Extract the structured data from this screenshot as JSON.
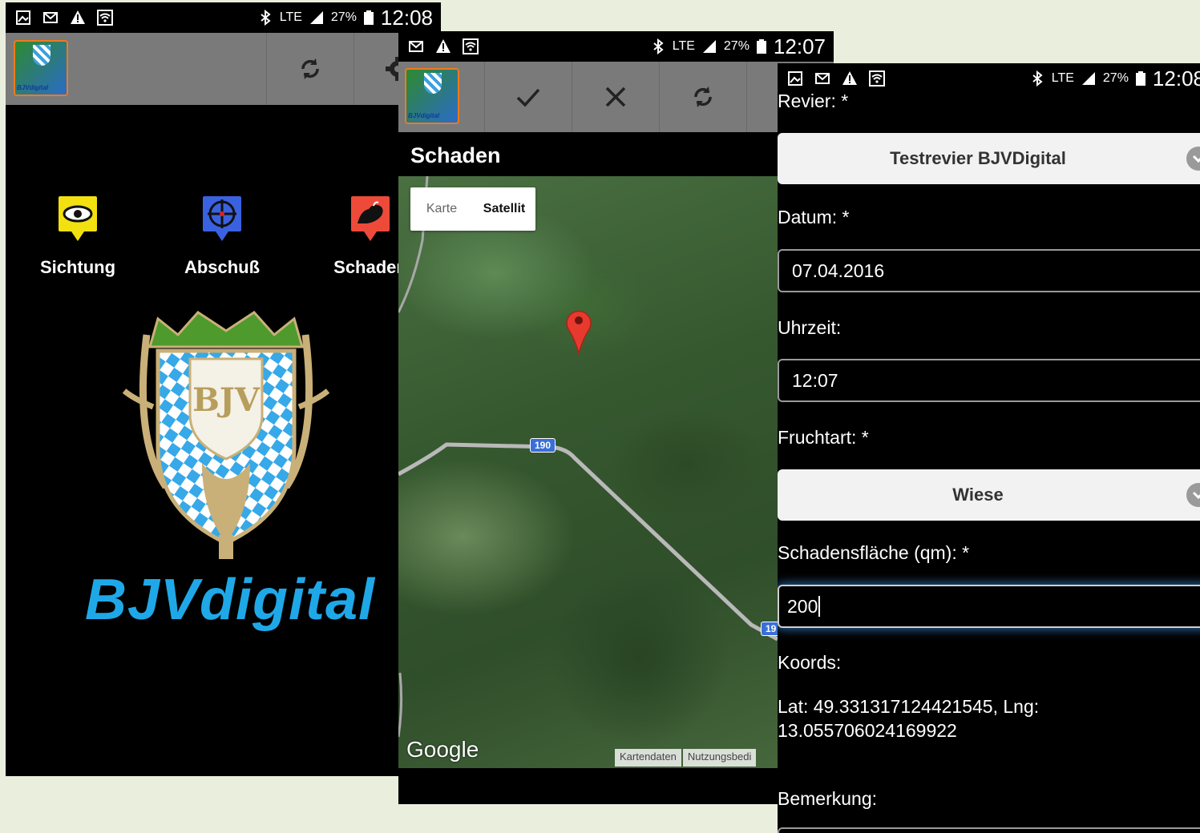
{
  "phone1": {
    "status": {
      "lte": "LTE",
      "battery": "27%",
      "clock": "12:08"
    },
    "tiles": [
      {
        "label": "Sichtung",
        "icon": "eye-icon",
        "color": "#f2e011"
      },
      {
        "label": "Abschuß",
        "icon": "crosshair-icon",
        "color": "#3a62e0"
      },
      {
        "label": "Schaden",
        "icon": "boar-icon",
        "color": "#ee4a3a"
      }
    ],
    "brand": "BJVdigital",
    "logo_letters": "BJV"
  },
  "phone2": {
    "status": {
      "lte": "LTE",
      "battery": "27%",
      "clock": "12:07"
    },
    "title": "Schaden",
    "map": {
      "type_karte": "Karte",
      "type_satellit": "Satellit",
      "road_label": "190",
      "road_label2": "19",
      "google": "Google",
      "kartendaten": "Kartendaten",
      "nutzung": "Nutzungsbedi"
    }
  },
  "phone3": {
    "status": {
      "lte": "LTE",
      "battery": "27%",
      "clock": "12:08"
    },
    "revier_label": "Revier: *",
    "revier_value": "Testrevier BJVDigital",
    "datum_label": "Datum: *",
    "datum_value": "07.04.2016",
    "uhrzeit_label": "Uhrzeit:",
    "uhrzeit_value": "12:07",
    "fruchtart_label": "Fruchtart: *",
    "fruchtart_value": "Wiese",
    "flaeche_label": "Schadensfläche (qm): *",
    "flaeche_value": "200",
    "koords_label": "Koords:",
    "koords_line1": "Lat: 49.331317124421545, Lng:",
    "koords_line2": "13.055706024169922",
    "bemerkung_label": "Bemerkung:"
  }
}
